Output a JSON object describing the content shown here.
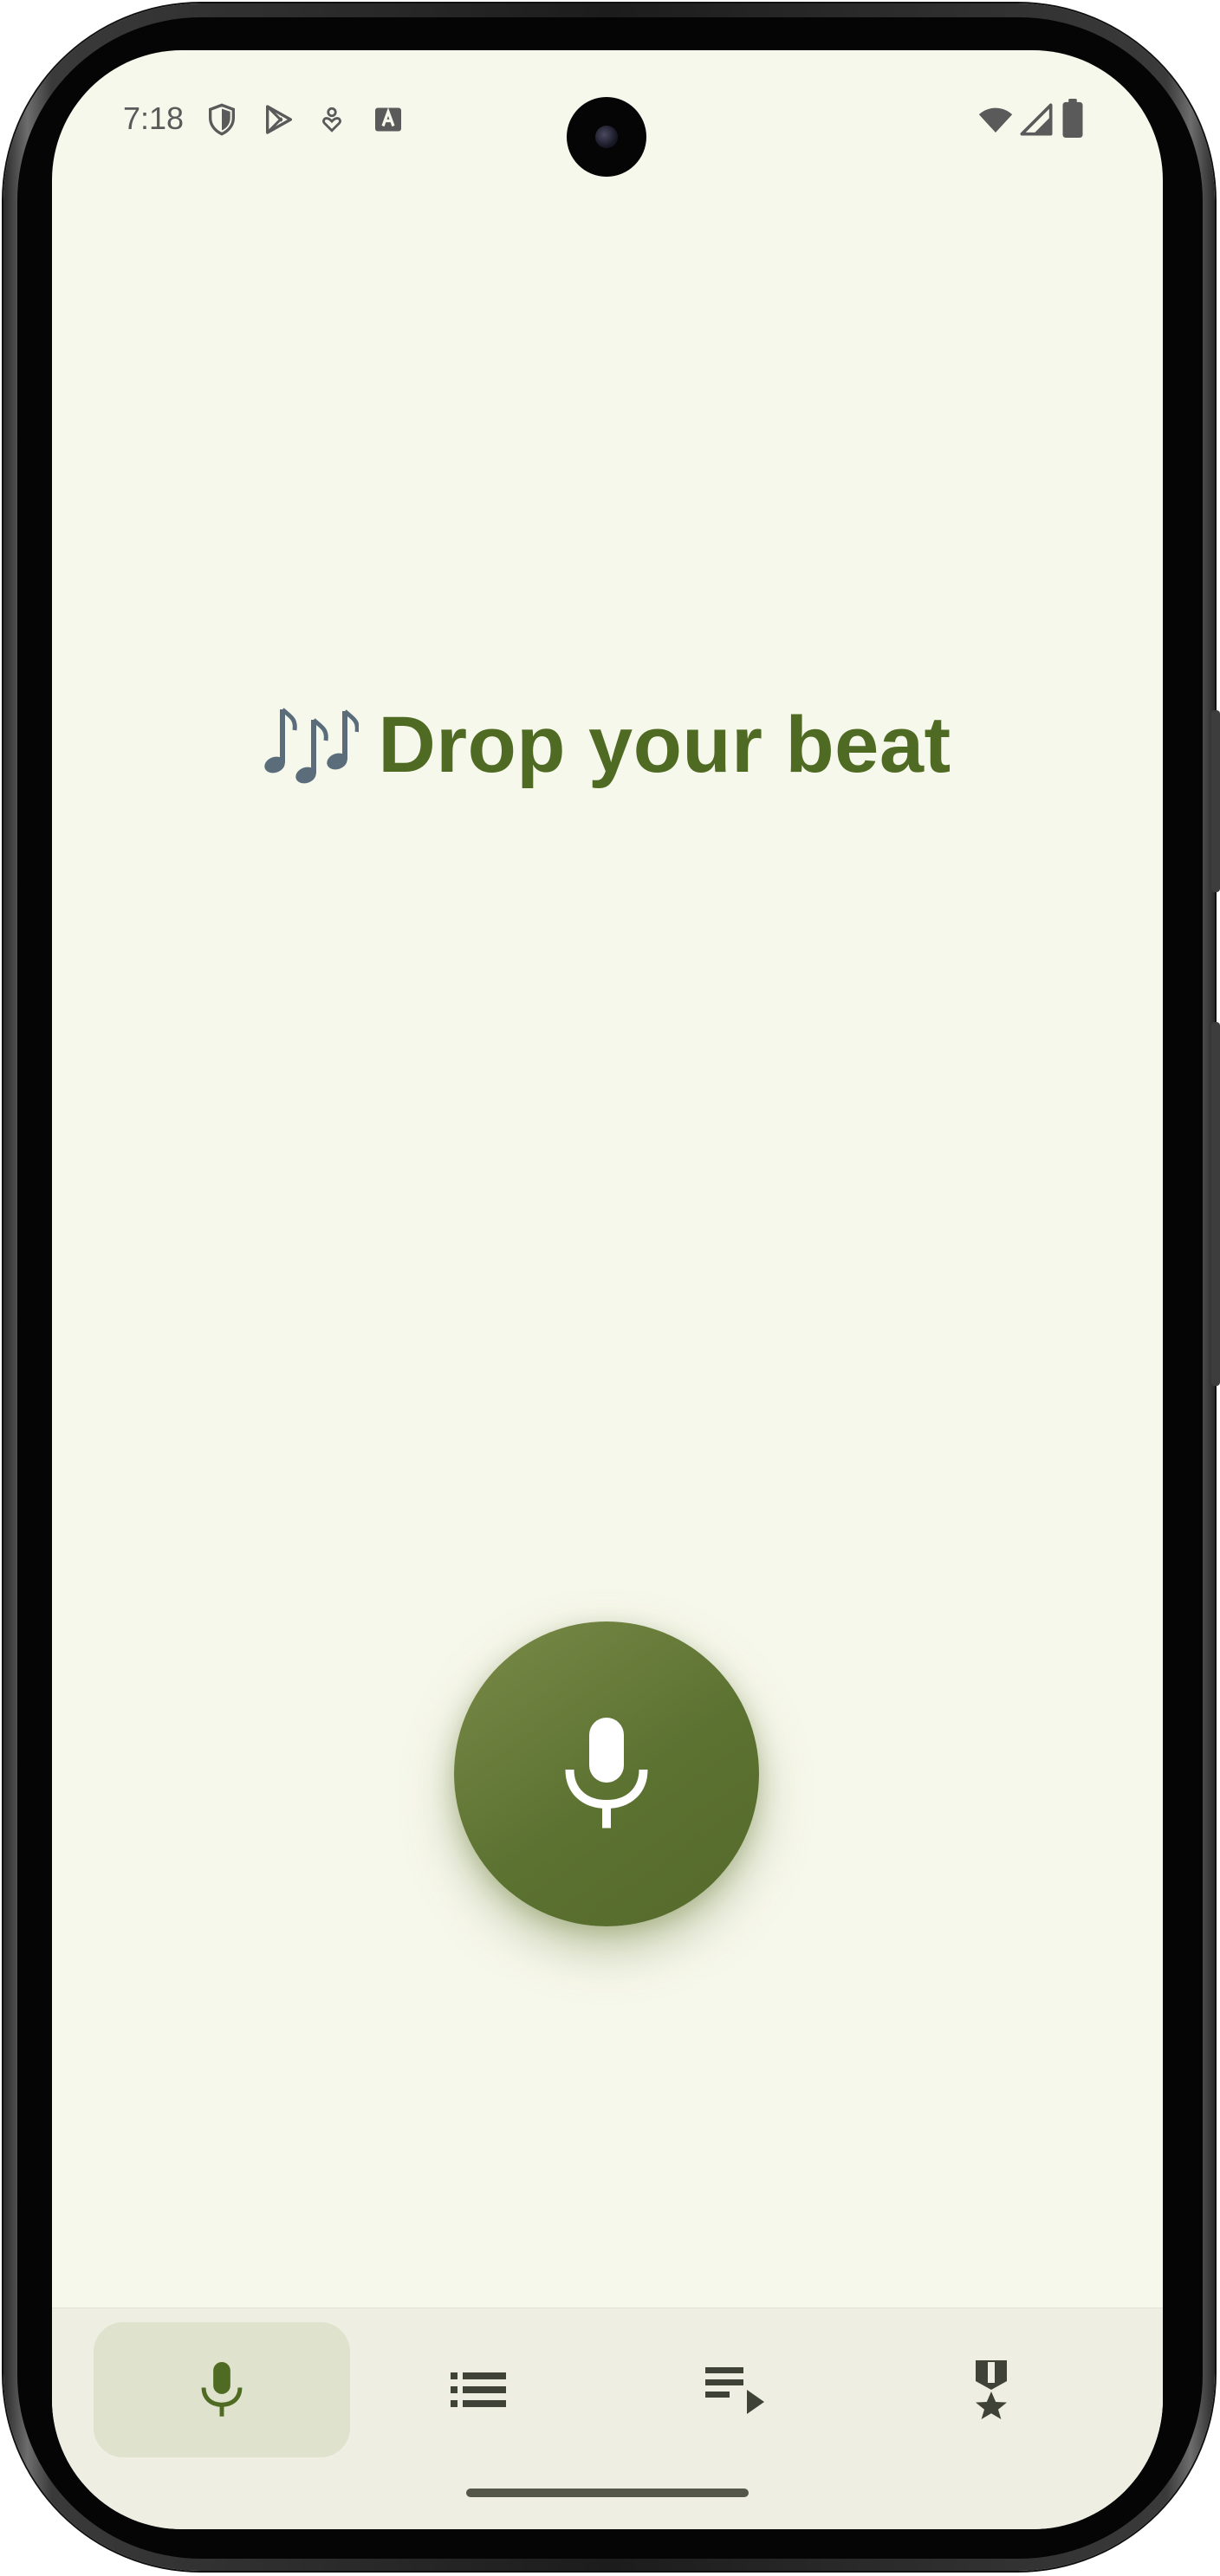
{
  "status_bar": {
    "time": "7:18",
    "left_icons": [
      "shield-icon",
      "play-store-icon",
      "location-heart-icon",
      "text-a-icon"
    ],
    "right_icons": [
      "wifi-icon",
      "signal-icon",
      "battery-icon"
    ]
  },
  "header": {
    "emoji": "🎶",
    "title": "Drop your beat"
  },
  "record_button": {
    "icon": "mic-icon"
  },
  "bottom_nav": {
    "items": [
      {
        "icon": "mic-icon",
        "active": true
      },
      {
        "icon": "list-icon",
        "active": false
      },
      {
        "icon": "playlist-play-icon",
        "active": false
      },
      {
        "icon": "medal-icon",
        "active": false
      }
    ]
  },
  "colors": {
    "screen_bg": "#f7f8ec",
    "accent": "#5c7231",
    "title": "#4f6b23",
    "nav_bg": "#eeefe2",
    "nav_active_bg": "#dfe2cc",
    "nav_icon": "#3f4237"
  }
}
